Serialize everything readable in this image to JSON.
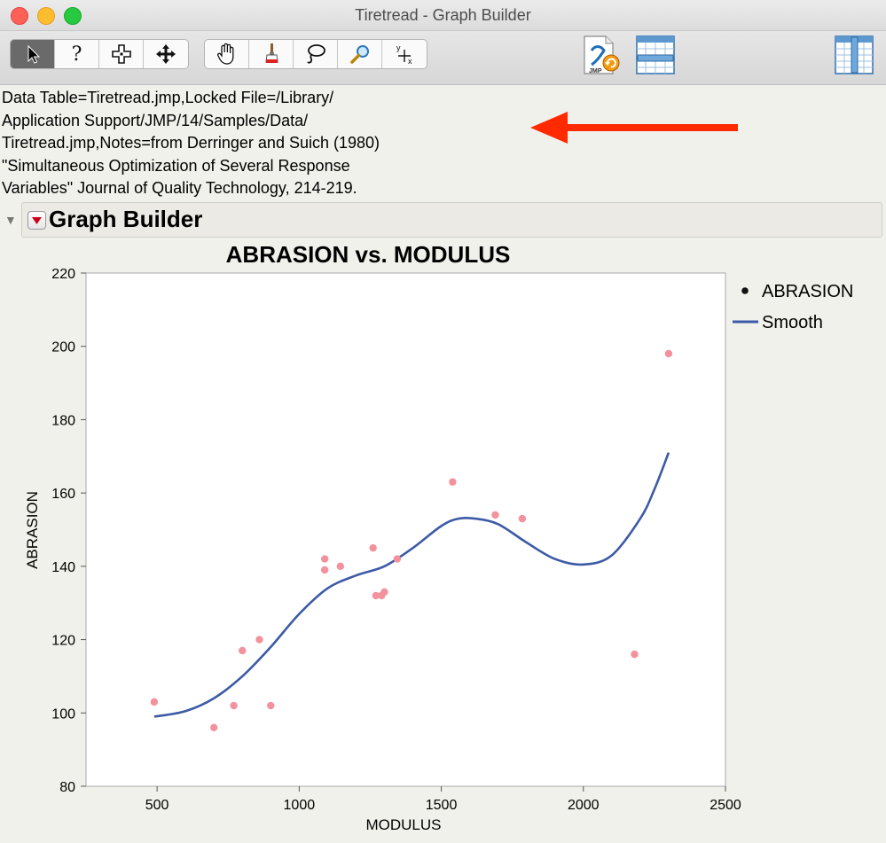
{
  "window": {
    "title": "Tiretread - Graph Builder"
  },
  "toolbar": {
    "tools": [
      "arrow",
      "help",
      "crosshair",
      "move",
      "grabber",
      "brush",
      "lasso",
      "magnifier",
      "annotate"
    ],
    "help_glyph": "?",
    "annotate_glyph_y": "y",
    "annotate_glyph_x": "x",
    "right_icons": [
      "jmp-script-icon",
      "data-table-icon",
      "column-panel-icon"
    ]
  },
  "info": {
    "lines": [
      "Data Table=Tiretread.jmp,Locked File=/Library/",
      "Application Support/JMP/14/Samples/Data/",
      "Tiretread.jmp,Notes=from Derringer and Suich (1980)",
      "\"Simultaneous Optimization of Several Response",
      "Variables\" Journal of Quality Technology, 214-219."
    ],
    "arrow_color": "#ff2a00"
  },
  "outline": {
    "title": "Graph Builder",
    "jmp_logo_text": "JMP"
  },
  "chart_data": {
    "type": "scatter",
    "title": "ABRASION vs. MODULUS",
    "xlabel": "MODULUS",
    "ylabel": "ABRASION",
    "xlim": [
      250,
      2500
    ],
    "ylim": [
      80,
      220
    ],
    "xticks": [
      500,
      1000,
      1500,
      2000,
      2500
    ],
    "yticks": [
      80,
      100,
      120,
      140,
      160,
      180,
      200,
      220
    ],
    "legend": {
      "position": "top-right",
      "entries": [
        "ABRASION",
        "Smooth"
      ]
    },
    "grid": false,
    "series": [
      {
        "name": "ABRASION",
        "kind": "points",
        "color": "#f3919d",
        "points": [
          [
            490,
            103
          ],
          [
            700,
            96
          ],
          [
            770,
            102
          ],
          [
            800,
            117
          ],
          [
            860,
            120
          ],
          [
            900,
            102
          ],
          [
            1090,
            139
          ],
          [
            1090,
            142
          ],
          [
            1145,
            140
          ],
          [
            1260,
            145
          ],
          [
            1270,
            132
          ],
          [
            1290,
            132
          ],
          [
            1300,
            133
          ],
          [
            1345,
            142
          ],
          [
            1540,
            163
          ],
          [
            1690,
            154
          ],
          [
            1785,
            153
          ],
          [
            2180,
            116
          ],
          [
            2300,
            198
          ]
        ]
      },
      {
        "name": "Smooth",
        "kind": "line",
        "color": "#3c5aa6",
        "points": [
          [
            490,
            99
          ],
          [
            600,
            100.5
          ],
          [
            700,
            104
          ],
          [
            800,
            110
          ],
          [
            900,
            118
          ],
          [
            1000,
            127
          ],
          [
            1100,
            134
          ],
          [
            1200,
            137.5
          ],
          [
            1300,
            140
          ],
          [
            1400,
            145
          ],
          [
            1500,
            151
          ],
          [
            1560,
            153
          ],
          [
            1620,
            153
          ],
          [
            1700,
            151.5
          ],
          [
            1800,
            146.5
          ],
          [
            1900,
            142
          ],
          [
            2000,
            140.5
          ],
          [
            2100,
            143
          ],
          [
            2200,
            153
          ],
          [
            2250,
            161
          ],
          [
            2300,
            171
          ]
        ]
      }
    ]
  }
}
